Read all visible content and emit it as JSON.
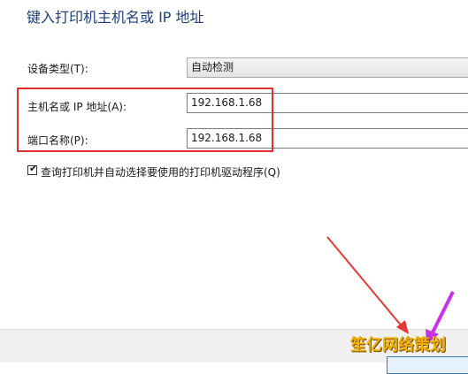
{
  "dialog": {
    "heading": "键入打印机主机名或 IP 地址"
  },
  "form": {
    "device_type_label": "设备类型(T):",
    "device_type_value": "自动检测",
    "hostname_label": "主机名或 IP 地址(A):",
    "hostname_value": "192.168.1.68",
    "port_label": "端口名称(P):",
    "port_value": "192.168.1.68",
    "query_checkbox_label": "查询打印机并自动选择要使用的打印机驱动程序(Q)",
    "query_checkbox_checked": true,
    "check_glyph": "✔"
  },
  "annotations": {
    "highlight_color": "#e03030",
    "arrow_red_color": "#e53935",
    "arrow_purple_color": "#c833e8"
  },
  "watermark": {
    "text": "笙亿网络策划"
  }
}
